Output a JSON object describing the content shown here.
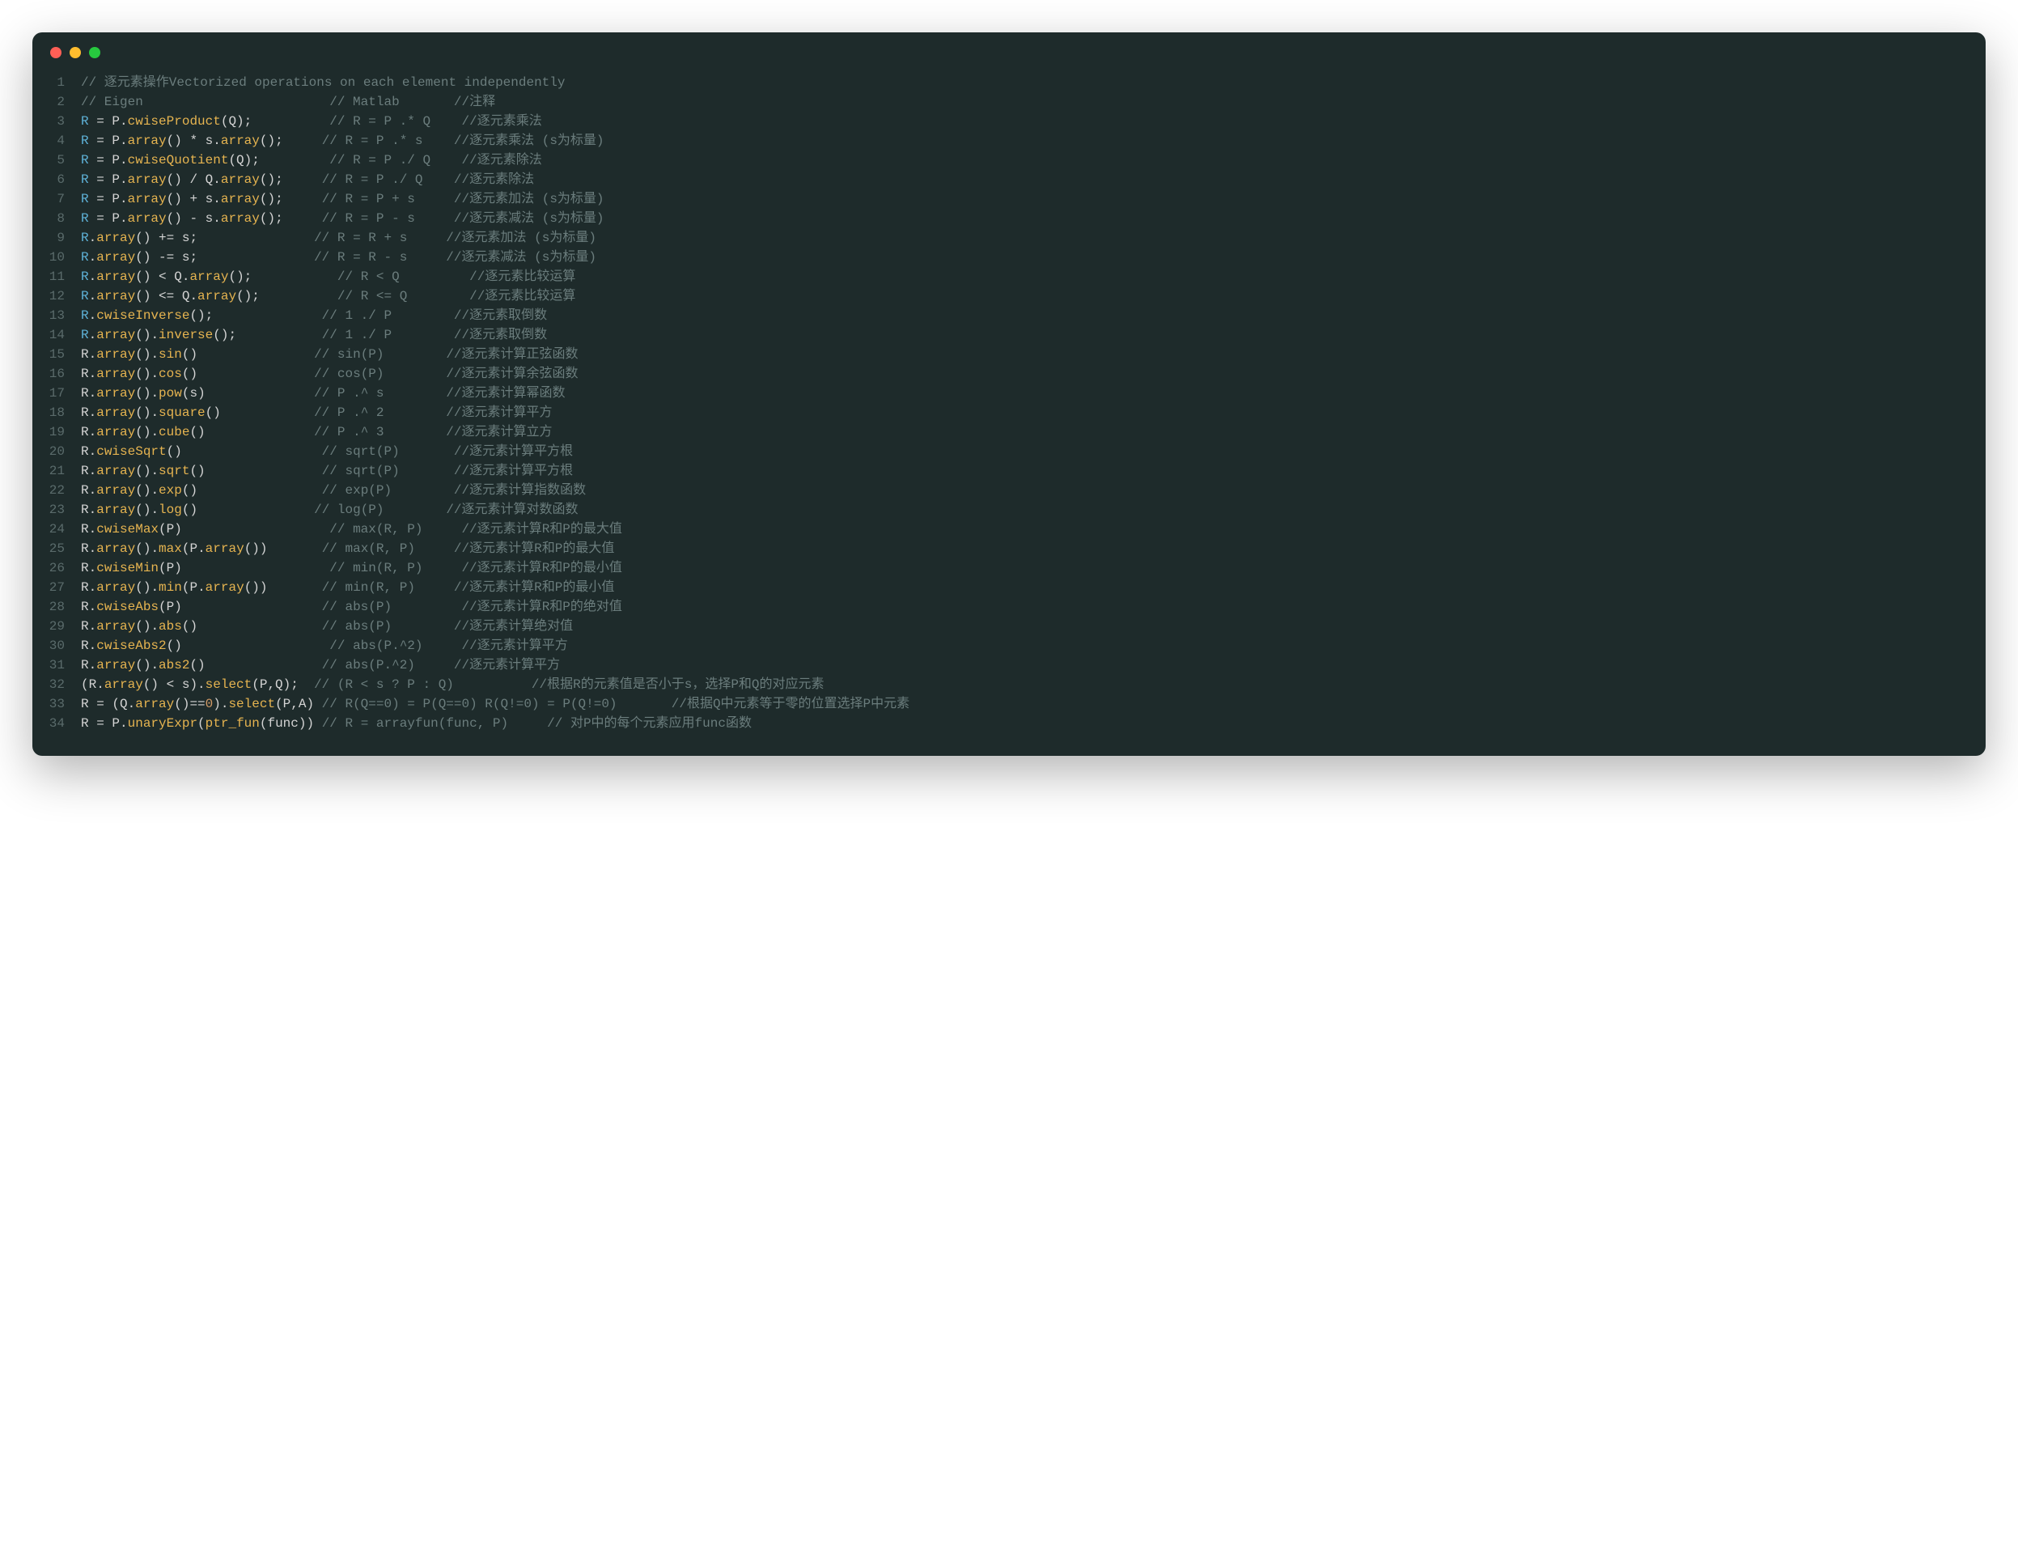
{
  "lines": [
    {
      "n": "1",
      "tokens": [
        {
          "t": "// 逐元素操作Vectorized operations on each element independently",
          "c": "c-comment"
        }
      ]
    },
    {
      "n": "2",
      "tokens": [
        {
          "t": "// Eigen                        // Matlab       //注释",
          "c": "c-comment"
        }
      ]
    },
    {
      "n": "3",
      "tokens": [
        {
          "t": "R",
          "c": "c-var"
        },
        {
          "t": " = P.",
          "c": "c-id"
        },
        {
          "t": "cwiseProduct",
          "c": "c-method"
        },
        {
          "t": "(Q);          ",
          "c": "c-id"
        },
        {
          "t": "// R = P .* Q    //逐元素乘法",
          "c": "c-comment"
        }
      ]
    },
    {
      "n": "4",
      "tokens": [
        {
          "t": "R",
          "c": "c-var"
        },
        {
          "t": " = P.",
          "c": "c-id"
        },
        {
          "t": "array",
          "c": "c-method"
        },
        {
          "t": "() * s.",
          "c": "c-id"
        },
        {
          "t": "array",
          "c": "c-method"
        },
        {
          "t": "();     ",
          "c": "c-id"
        },
        {
          "t": "// R = P .* s    //逐元素乘法 (s为标量)",
          "c": "c-comment"
        }
      ]
    },
    {
      "n": "5",
      "tokens": [
        {
          "t": "R",
          "c": "c-var"
        },
        {
          "t": " = P.",
          "c": "c-id"
        },
        {
          "t": "cwiseQuotient",
          "c": "c-method"
        },
        {
          "t": "(Q);         ",
          "c": "c-id"
        },
        {
          "t": "// R = P ./ Q    //逐元素除法",
          "c": "c-comment"
        }
      ]
    },
    {
      "n": "6",
      "tokens": [
        {
          "t": "R",
          "c": "c-var"
        },
        {
          "t": " = P.",
          "c": "c-id"
        },
        {
          "t": "array",
          "c": "c-method"
        },
        {
          "t": "() / Q.",
          "c": "c-id"
        },
        {
          "t": "array",
          "c": "c-method"
        },
        {
          "t": "();     ",
          "c": "c-id"
        },
        {
          "t": "// R = P ./ Q    //逐元素除法",
          "c": "c-comment"
        }
      ]
    },
    {
      "n": "7",
      "tokens": [
        {
          "t": "R",
          "c": "c-var"
        },
        {
          "t": " = P.",
          "c": "c-id"
        },
        {
          "t": "array",
          "c": "c-method"
        },
        {
          "t": "() + s.",
          "c": "c-id"
        },
        {
          "t": "array",
          "c": "c-method"
        },
        {
          "t": "();     ",
          "c": "c-id"
        },
        {
          "t": "// R = P + s     //逐元素加法 (s为标量)",
          "c": "c-comment"
        }
      ]
    },
    {
      "n": "8",
      "tokens": [
        {
          "t": "R",
          "c": "c-var"
        },
        {
          "t": " = P.",
          "c": "c-id"
        },
        {
          "t": "array",
          "c": "c-method"
        },
        {
          "t": "() - s.",
          "c": "c-id"
        },
        {
          "t": "array",
          "c": "c-method"
        },
        {
          "t": "();     ",
          "c": "c-id"
        },
        {
          "t": "// R = P - s     //逐元素减法 (s为标量)",
          "c": "c-comment"
        }
      ]
    },
    {
      "n": "9",
      "tokens": [
        {
          "t": "R",
          "c": "c-var"
        },
        {
          "t": ".",
          "c": "c-id"
        },
        {
          "t": "array",
          "c": "c-method"
        },
        {
          "t": "() += s;               ",
          "c": "c-id"
        },
        {
          "t": "// R = R + s     //逐元素加法 (s为标量)",
          "c": "c-comment"
        }
      ]
    },
    {
      "n": "10",
      "tokens": [
        {
          "t": "R",
          "c": "c-var"
        },
        {
          "t": ".",
          "c": "c-id"
        },
        {
          "t": "array",
          "c": "c-method"
        },
        {
          "t": "() -= s;               ",
          "c": "c-id"
        },
        {
          "t": "// R = R - s     //逐元素减法 (s为标量)",
          "c": "c-comment"
        }
      ]
    },
    {
      "n": "11",
      "tokens": [
        {
          "t": "R",
          "c": "c-var"
        },
        {
          "t": ".",
          "c": "c-id"
        },
        {
          "t": "array",
          "c": "c-method"
        },
        {
          "t": "() < Q.",
          "c": "c-id"
        },
        {
          "t": "array",
          "c": "c-method"
        },
        {
          "t": "();           ",
          "c": "c-id"
        },
        {
          "t": "// R < Q         //逐元素比较运算",
          "c": "c-comment"
        }
      ]
    },
    {
      "n": "12",
      "tokens": [
        {
          "t": "R",
          "c": "c-var"
        },
        {
          "t": ".",
          "c": "c-id"
        },
        {
          "t": "array",
          "c": "c-method"
        },
        {
          "t": "() <= Q.",
          "c": "c-id"
        },
        {
          "t": "array",
          "c": "c-method"
        },
        {
          "t": "();          ",
          "c": "c-id"
        },
        {
          "t": "// R <= Q        //逐元素比较运算",
          "c": "c-comment"
        }
      ]
    },
    {
      "n": "13",
      "tokens": [
        {
          "t": "R",
          "c": "c-var"
        },
        {
          "t": ".",
          "c": "c-id"
        },
        {
          "t": "cwiseInverse",
          "c": "c-method"
        },
        {
          "t": "();              ",
          "c": "c-id"
        },
        {
          "t": "// 1 ./ P        //逐元素取倒数",
          "c": "c-comment"
        }
      ]
    },
    {
      "n": "14",
      "tokens": [
        {
          "t": "R",
          "c": "c-var"
        },
        {
          "t": ".",
          "c": "c-id"
        },
        {
          "t": "array",
          "c": "c-method"
        },
        {
          "t": "().",
          "c": "c-id"
        },
        {
          "t": "inverse",
          "c": "c-method"
        },
        {
          "t": "();           ",
          "c": "c-id"
        },
        {
          "t": "// 1 ./ P        //逐元素取倒数",
          "c": "c-comment"
        }
      ]
    },
    {
      "n": "15",
      "tokens": [
        {
          "t": "R",
          "c": "c-id"
        },
        {
          "t": ".",
          "c": "c-id"
        },
        {
          "t": "array",
          "c": "c-method"
        },
        {
          "t": "().",
          "c": "c-id"
        },
        {
          "t": "sin",
          "c": "c-method"
        },
        {
          "t": "()               ",
          "c": "c-id"
        },
        {
          "t": "// sin(P)        //逐元素计算正弦函数",
          "c": "c-comment"
        }
      ]
    },
    {
      "n": "16",
      "tokens": [
        {
          "t": "R",
          "c": "c-id"
        },
        {
          "t": ".",
          "c": "c-id"
        },
        {
          "t": "array",
          "c": "c-method"
        },
        {
          "t": "().",
          "c": "c-id"
        },
        {
          "t": "cos",
          "c": "c-method"
        },
        {
          "t": "()               ",
          "c": "c-id"
        },
        {
          "t": "// cos(P)        //逐元素计算余弦函数",
          "c": "c-comment"
        }
      ]
    },
    {
      "n": "17",
      "tokens": [
        {
          "t": "R",
          "c": "c-id"
        },
        {
          "t": ".",
          "c": "c-id"
        },
        {
          "t": "array",
          "c": "c-method"
        },
        {
          "t": "().",
          "c": "c-id"
        },
        {
          "t": "pow",
          "c": "c-method"
        },
        {
          "t": "(s)              ",
          "c": "c-id"
        },
        {
          "t": "// P .^ s        //逐元素计算幂函数",
          "c": "c-comment"
        }
      ]
    },
    {
      "n": "18",
      "tokens": [
        {
          "t": "R",
          "c": "c-id"
        },
        {
          "t": ".",
          "c": "c-id"
        },
        {
          "t": "array",
          "c": "c-method"
        },
        {
          "t": "().",
          "c": "c-id"
        },
        {
          "t": "square",
          "c": "c-method"
        },
        {
          "t": "()            ",
          "c": "c-id"
        },
        {
          "t": "// P .^ 2        //逐元素计算平方",
          "c": "c-comment"
        }
      ]
    },
    {
      "n": "19",
      "tokens": [
        {
          "t": "R",
          "c": "c-id"
        },
        {
          "t": ".",
          "c": "c-id"
        },
        {
          "t": "array",
          "c": "c-method"
        },
        {
          "t": "().",
          "c": "c-id"
        },
        {
          "t": "cube",
          "c": "c-method"
        },
        {
          "t": "()              ",
          "c": "c-id"
        },
        {
          "t": "// P .^ 3        //逐元素计算立方",
          "c": "c-comment"
        }
      ]
    },
    {
      "n": "20",
      "tokens": [
        {
          "t": "R",
          "c": "c-id"
        },
        {
          "t": ".",
          "c": "c-id"
        },
        {
          "t": "cwiseSqrt",
          "c": "c-method"
        },
        {
          "t": "()                  ",
          "c": "c-id"
        },
        {
          "t": "// sqrt(P)       //逐元素计算平方根",
          "c": "c-comment"
        }
      ]
    },
    {
      "n": "21",
      "tokens": [
        {
          "t": "R",
          "c": "c-id"
        },
        {
          "t": ".",
          "c": "c-id"
        },
        {
          "t": "array",
          "c": "c-method"
        },
        {
          "t": "().",
          "c": "c-id"
        },
        {
          "t": "sqrt",
          "c": "c-method"
        },
        {
          "t": "()               ",
          "c": "c-id"
        },
        {
          "t": "// sqrt(P)       //逐元素计算平方根",
          "c": "c-comment"
        }
      ]
    },
    {
      "n": "22",
      "tokens": [
        {
          "t": "R",
          "c": "c-id"
        },
        {
          "t": ".",
          "c": "c-id"
        },
        {
          "t": "array",
          "c": "c-method"
        },
        {
          "t": "().",
          "c": "c-id"
        },
        {
          "t": "exp",
          "c": "c-method"
        },
        {
          "t": "()                ",
          "c": "c-id"
        },
        {
          "t": "// exp(P)        //逐元素计算指数函数",
          "c": "c-comment"
        }
      ]
    },
    {
      "n": "23",
      "tokens": [
        {
          "t": "R",
          "c": "c-id"
        },
        {
          "t": ".",
          "c": "c-id"
        },
        {
          "t": "array",
          "c": "c-method"
        },
        {
          "t": "().",
          "c": "c-id"
        },
        {
          "t": "log",
          "c": "c-method"
        },
        {
          "t": "()               ",
          "c": "c-id"
        },
        {
          "t": "// log(P)        //逐元素计算对数函数",
          "c": "c-comment"
        }
      ]
    },
    {
      "n": "24",
      "tokens": [
        {
          "t": "R",
          "c": "c-id"
        },
        {
          "t": ".",
          "c": "c-id"
        },
        {
          "t": "cwiseMax",
          "c": "c-method"
        },
        {
          "t": "(P)                   ",
          "c": "c-id"
        },
        {
          "t": "// max(R, P)     //逐元素计算R和P的最大值",
          "c": "c-comment"
        }
      ]
    },
    {
      "n": "25",
      "tokens": [
        {
          "t": "R",
          "c": "c-id"
        },
        {
          "t": ".",
          "c": "c-id"
        },
        {
          "t": "array",
          "c": "c-method"
        },
        {
          "t": "().",
          "c": "c-id"
        },
        {
          "t": "max",
          "c": "c-method"
        },
        {
          "t": "(P.",
          "c": "c-id"
        },
        {
          "t": "array",
          "c": "c-method"
        },
        {
          "t": "())       ",
          "c": "c-id"
        },
        {
          "t": "// max(R, P)     //逐元素计算R和P的最大值",
          "c": "c-comment"
        }
      ]
    },
    {
      "n": "26",
      "tokens": [
        {
          "t": "R",
          "c": "c-id"
        },
        {
          "t": ".",
          "c": "c-id"
        },
        {
          "t": "cwiseMin",
          "c": "c-method"
        },
        {
          "t": "(P)                   ",
          "c": "c-id"
        },
        {
          "t": "// min(R, P)     //逐元素计算R和P的最小值",
          "c": "c-comment"
        }
      ]
    },
    {
      "n": "27",
      "tokens": [
        {
          "t": "R",
          "c": "c-id"
        },
        {
          "t": ".",
          "c": "c-id"
        },
        {
          "t": "array",
          "c": "c-method"
        },
        {
          "t": "().",
          "c": "c-id"
        },
        {
          "t": "min",
          "c": "c-method"
        },
        {
          "t": "(P.",
          "c": "c-id"
        },
        {
          "t": "array",
          "c": "c-method"
        },
        {
          "t": "())       ",
          "c": "c-id"
        },
        {
          "t": "// min(R, P)     //逐元素计算R和P的最小值",
          "c": "c-comment"
        }
      ]
    },
    {
      "n": "28",
      "tokens": [
        {
          "t": "R",
          "c": "c-id"
        },
        {
          "t": ".",
          "c": "c-id"
        },
        {
          "t": "cwiseAbs",
          "c": "c-method"
        },
        {
          "t": "(P)                  ",
          "c": "c-id"
        },
        {
          "t": "// abs(P)         //逐元素计算R和P的绝对值",
          "c": "c-comment"
        }
      ]
    },
    {
      "n": "29",
      "tokens": [
        {
          "t": "R",
          "c": "c-id"
        },
        {
          "t": ".",
          "c": "c-id"
        },
        {
          "t": "array",
          "c": "c-method"
        },
        {
          "t": "().",
          "c": "c-id"
        },
        {
          "t": "abs",
          "c": "c-method"
        },
        {
          "t": "()                ",
          "c": "c-id"
        },
        {
          "t": "// abs(P)        //逐元素计算绝对值",
          "c": "c-comment"
        }
      ]
    },
    {
      "n": "30",
      "tokens": [
        {
          "t": "R",
          "c": "c-id"
        },
        {
          "t": ".",
          "c": "c-id"
        },
        {
          "t": "cwiseAbs2",
          "c": "c-method"
        },
        {
          "t": "()                   ",
          "c": "c-id"
        },
        {
          "t": "// abs(P.^2)     //逐元素计算平方",
          "c": "c-comment"
        }
      ]
    },
    {
      "n": "31",
      "tokens": [
        {
          "t": "R",
          "c": "c-id"
        },
        {
          "t": ".",
          "c": "c-id"
        },
        {
          "t": "array",
          "c": "c-method"
        },
        {
          "t": "().",
          "c": "c-id"
        },
        {
          "t": "abs2",
          "c": "c-method"
        },
        {
          "t": "()               ",
          "c": "c-id"
        },
        {
          "t": "// abs(P.^2)     //逐元素计算平方",
          "c": "c-comment"
        }
      ]
    },
    {
      "n": "32",
      "tokens": [
        {
          "t": "(R.",
          "c": "c-id"
        },
        {
          "t": "array",
          "c": "c-method"
        },
        {
          "t": "() < s).",
          "c": "c-id"
        },
        {
          "t": "select",
          "c": "c-method"
        },
        {
          "t": "(P,Q);  ",
          "c": "c-id"
        },
        {
          "t": "// (R < s ? P : Q)          //根据R的元素值是否小于s，选择P和Q的对应元素",
          "c": "c-comment"
        }
      ]
    },
    {
      "n": "33",
      "tokens": [
        {
          "t": "R",
          "c": "c-id"
        },
        {
          "t": " = (Q.",
          "c": "c-id"
        },
        {
          "t": "array",
          "c": "c-method"
        },
        {
          "t": "()==",
          "c": "c-id"
        },
        {
          "t": "0",
          "c": "c-num"
        },
        {
          "t": ").",
          "c": "c-id"
        },
        {
          "t": "select",
          "c": "c-method"
        },
        {
          "t": "(P,A) ",
          "c": "c-id"
        },
        {
          "t": "// R(Q==0) = P(Q==0) R(Q!=0) = P(Q!=0)       //根据Q中元素等于零的位置选择P中元素",
          "c": "c-comment"
        }
      ]
    },
    {
      "n": "34",
      "tokens": [
        {
          "t": "R",
          "c": "c-id"
        },
        {
          "t": " = P.",
          "c": "c-id"
        },
        {
          "t": "unaryExpr",
          "c": "c-method"
        },
        {
          "t": "(",
          "c": "c-id"
        },
        {
          "t": "ptr_fun",
          "c": "c-method"
        },
        {
          "t": "(func)) ",
          "c": "c-id"
        },
        {
          "t": "// R = arrayfun(func, P)     // 对P中的每个元素应用func函数",
          "c": "c-comment"
        }
      ]
    }
  ]
}
